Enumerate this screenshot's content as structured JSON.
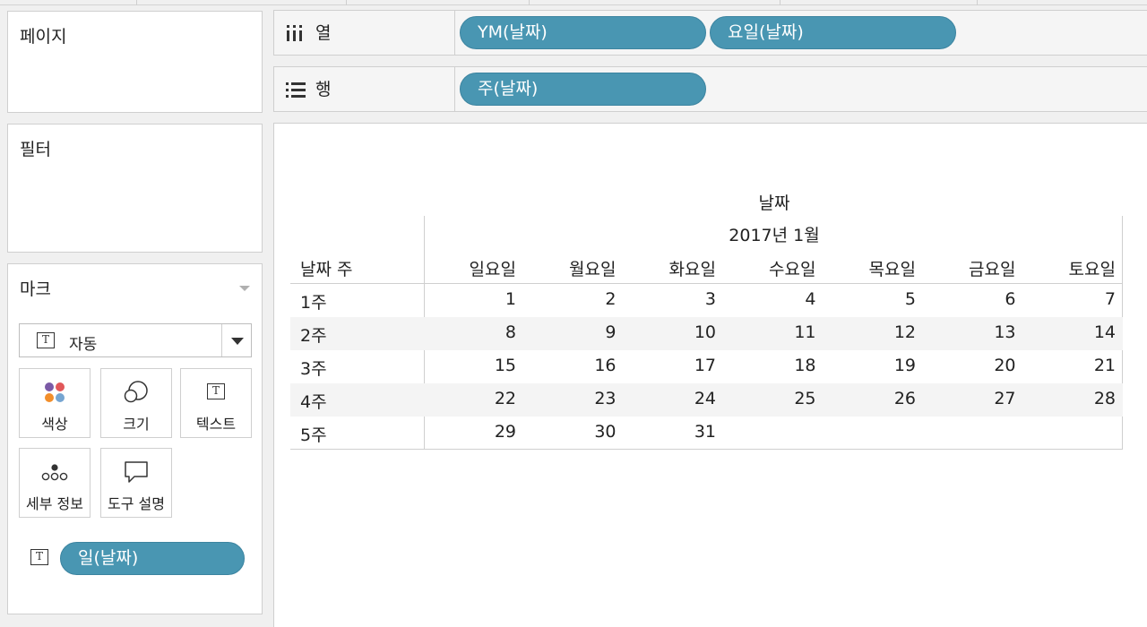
{
  "cards": {
    "pages": "페이지",
    "filters": "필터",
    "marks": "마크"
  },
  "marks": {
    "type_label": "자동",
    "buttons": {
      "color": "색상",
      "size": "크기",
      "text": "텍스트",
      "detail": "세부 정보",
      "tooltip": "도구 설명"
    },
    "text_field": "일(날짜)"
  },
  "shelves": {
    "columns": {
      "label": "열",
      "pills": [
        "YM(날짜)",
        "요일(날짜)"
      ]
    },
    "rows": {
      "label": "행",
      "pills": [
        "주(날짜)"
      ]
    }
  },
  "icon_names": [
    "text-icon",
    "color-dots-icon",
    "size-circles-icon",
    "detail-dots-icon",
    "tooltip-bubble-icon",
    "columns-icon",
    "rows-icon",
    "chevron-down-icon"
  ],
  "colors": {
    "pill": "#4996b2",
    "dot_purple": "#7b5aa6",
    "dot_red": "#e15759",
    "dot_orange": "#f28e2b",
    "dot_blue": "#76a5d1"
  },
  "chart_data": {
    "type": "table",
    "title": "날짜",
    "subtitle": "2017년 1월",
    "row_header": "날짜 주",
    "columns": [
      "일요일",
      "월요일",
      "화요일",
      "수요일",
      "목요일",
      "금요일",
      "토요일"
    ],
    "rows": [
      {
        "label": "1주",
        "values": [
          "1",
          "2",
          "3",
          "4",
          "5",
          "6",
          "7"
        ]
      },
      {
        "label": "2주",
        "values": [
          "8",
          "9",
          "10",
          "11",
          "12",
          "13",
          "14"
        ]
      },
      {
        "label": "3주",
        "values": [
          "15",
          "16",
          "17",
          "18",
          "19",
          "20",
          "21"
        ]
      },
      {
        "label": "4주",
        "values": [
          "22",
          "23",
          "24",
          "25",
          "26",
          "27",
          "28"
        ]
      },
      {
        "label": "5주",
        "values": [
          "29",
          "30",
          "31",
          "",
          "",
          "",
          ""
        ]
      }
    ]
  }
}
